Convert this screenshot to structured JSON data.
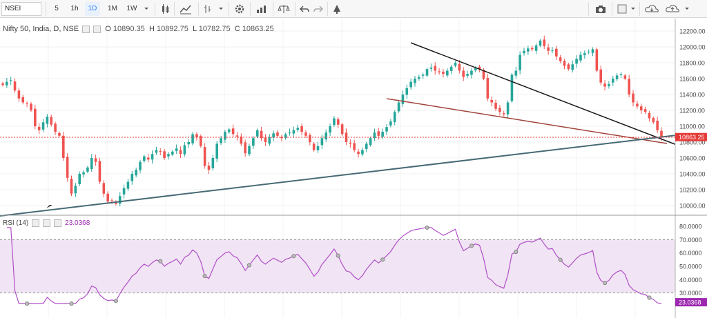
{
  "toolbar": {
    "symbol": "NSEI",
    "intervals": [
      "5",
      "1h",
      "1D",
      "1M",
      "1W"
    ],
    "active_interval": "1D",
    "icons": [
      "candles-icon",
      "line-style-icon",
      "indicators-icon",
      "settings-icon",
      "compare-icon",
      "scale-icon",
      "undo-icon",
      "redo-icon",
      "alert-icon",
      "camera-icon",
      "square-icon",
      "cloud-down-icon",
      "cloud-up-icon"
    ]
  },
  "legend": {
    "title": "Nifty 50, India, D, NSE",
    "open_label": "O",
    "open": "10890.35",
    "high_label": "H",
    "high": "10892.75",
    "low_label": "L",
    "low": "10782.75",
    "close_label": "C",
    "close": "10863.25"
  },
  "rsi_legend": {
    "name": "RSI (14)",
    "value": "23.0368"
  },
  "colors": {
    "up": "#26a69a",
    "down": "#ef5350",
    "rsi_line": "#b04fc7",
    "rsi_band": "#f1e4f4",
    "trend_black": "#1a1a1a",
    "trend_brown": "#a0443a",
    "trend_teal": "#466a75",
    "price_tag": "#e53935",
    "rsi_tag": "#9c27b0"
  },
  "price_axis": {
    "ticks": [
      "12200.00",
      "12000.00",
      "11800.00",
      "11600.00",
      "11400.00",
      "11200.00",
      "11000.00",
      "10800.00",
      "10600.00",
      "10400.00",
      "10200.00",
      "10000.00"
    ],
    "current": "10863.25"
  },
  "rsi_axis": {
    "ticks": [
      "80.0000",
      "70.0000",
      "60.0000",
      "50.0000",
      "40.0000",
      "30.0000"
    ],
    "current": "23.0368"
  },
  "chart_data": {
    "type": "candlestick",
    "title": "Nifty 50, India, D, NSE",
    "ylim": [
      9900,
      12300
    ],
    "closes": [
      11520,
      11560,
      11580,
      11450,
      11350,
      11300,
      11280,
      11200,
      11000,
      10950,
      11050,
      11120,
      11020,
      10930,
      10880,
      10600,
      10350,
      10150,
      10250,
      10400,
      10420,
      10480,
      10600,
      10550,
      10300,
      10150,
      10050,
      10060,
      10020,
      10120,
      10220,
      10300,
      10400,
      10450,
      10550,
      10620,
      10580,
      10650,
      10700,
      10680,
      10600,
      10650,
      10680,
      10720,
      10650,
      10760,
      10800,
      10900,
      10860,
      10750,
      10500,
      10450,
      10600,
      10780,
      10850,
      10930,
      10960,
      10900,
      10870,
      10780,
      10660,
      10750,
      10850,
      10950,
      10850,
      10800,
      10860,
      10910,
      10880,
      10850,
      10900,
      10920,
      10950,
      10980,
      10930,
      10880,
      10800,
      10700,
      10750,
      10850,
      10920,
      11000,
      11100,
      11020,
      10900,
      10800,
      10780,
      10700,
      10650,
      10700,
      10780,
      10850,
      10920,
      10880,
      10930,
      10990,
      11060,
      11180,
      11300,
      11400,
      11480,
      11560,
      11600,
      11620,
      11650,
      11720,
      11740,
      11700,
      11680,
      11660,
      11700,
      11750,
      11800,
      11700,
      11620,
      11660,
      11700,
      11730,
      11720,
      11600,
      11350,
      11300,
      11220,
      11180,
      11150,
      11300,
      11650,
      11700,
      11900,
      11950,
      11980,
      11970,
      12020,
      12080,
      12010,
      11950,
      11960,
      11880,
      11820,
      11760,
      11720,
      11780,
      11850,
      11900,
      11920,
      11940,
      11970,
      11700,
      11550,
      11500,
      11530,
      11600,
      11640,
      11660,
      11600,
      11400,
      11300,
      11250,
      11200,
      11180,
      11100,
      11050,
      10950,
      10863
    ]
  }
}
